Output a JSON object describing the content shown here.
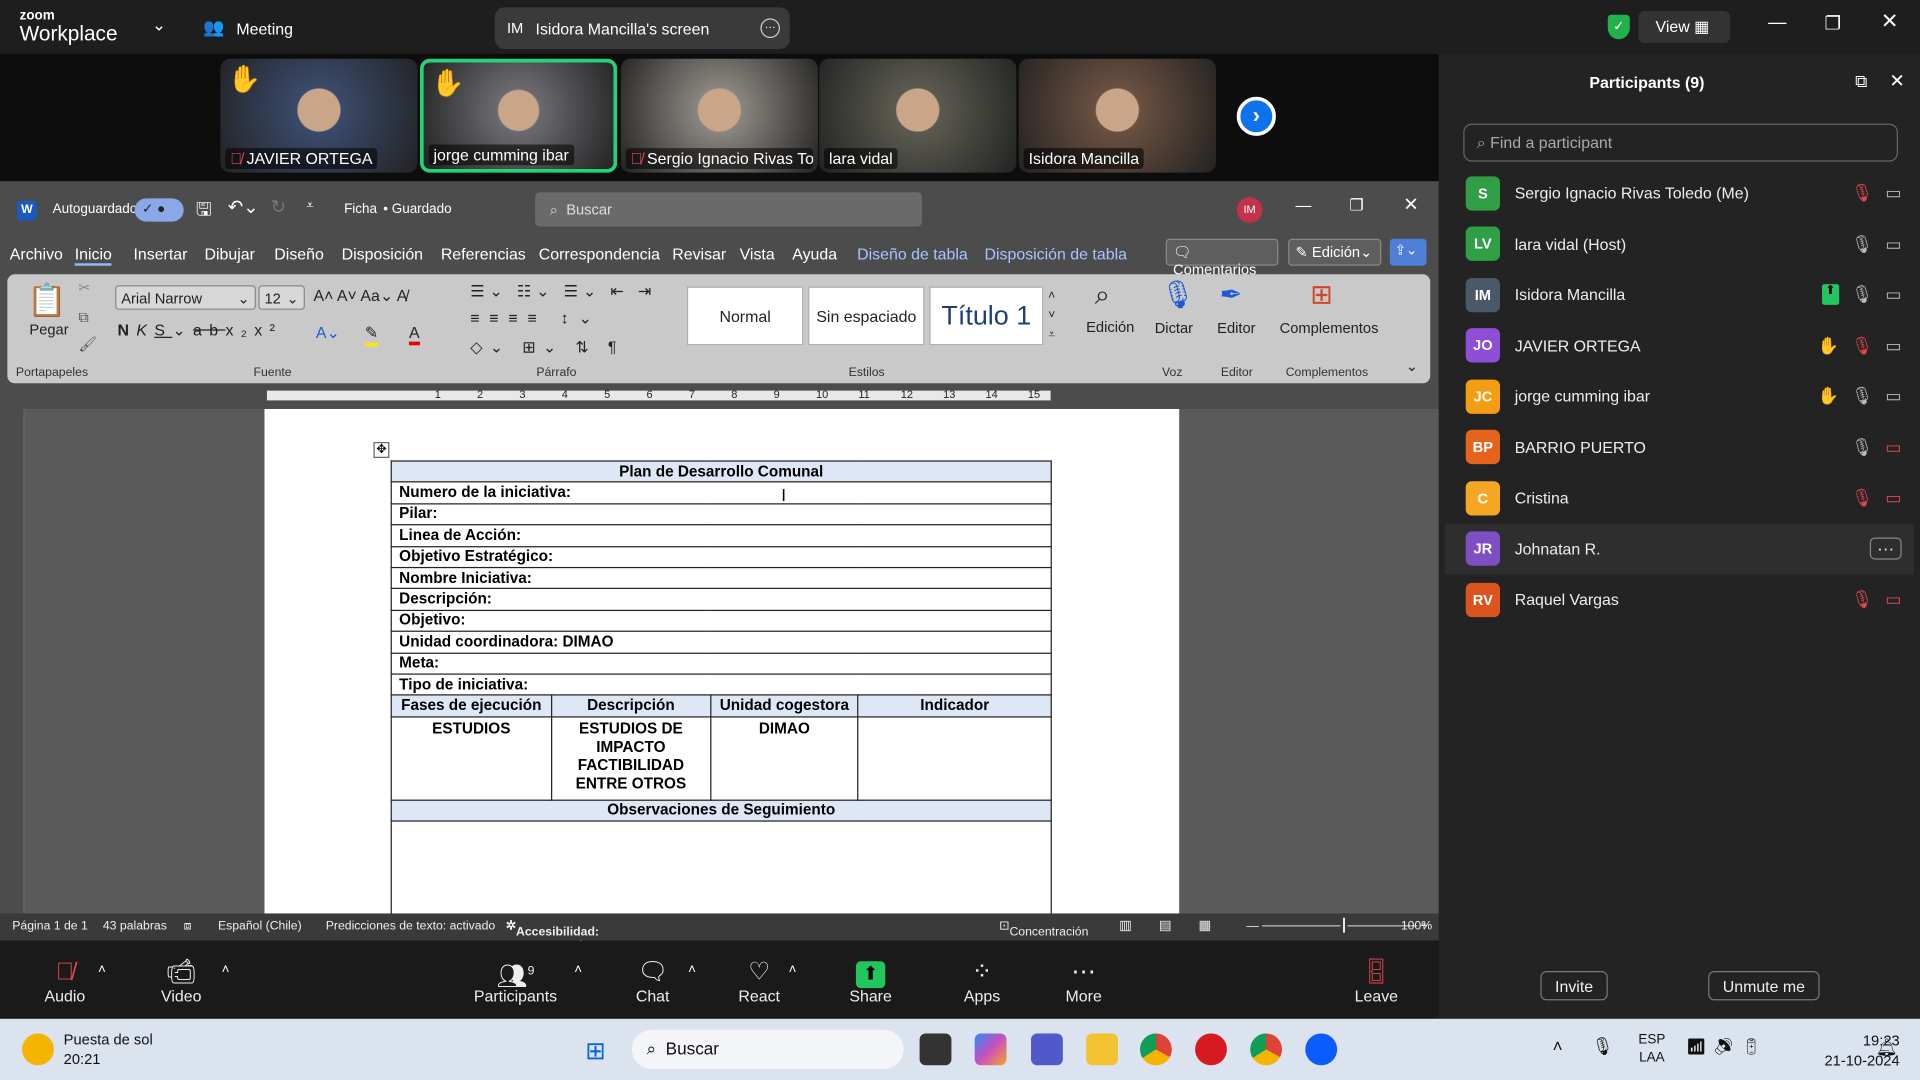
{
  "zoom": {
    "logo_small": "zoom",
    "logo_big": "Workplace",
    "meeting_label": "Meeting",
    "share_pill": "Isidora Mancilla's screen",
    "share_initials": "IM",
    "view_label": "View"
  },
  "videos": [
    {
      "name": "JAVIER ORTEGA",
      "muted": true,
      "hand": true,
      "color": "#3a4a6a"
    },
    {
      "name": "jorge cumming ibar",
      "muted": false,
      "hand": true,
      "active": true,
      "color": "#6a6a70"
    },
    {
      "name": "Sergio Ignacio Rivas To...",
      "muted": true,
      "hand": false,
      "color": "#8a8580"
    },
    {
      "name": "lara vidal",
      "muted": false,
      "hand": false,
      "color": "#5a5a50"
    },
    {
      "name": "Isidora Mancilla",
      "muted": false,
      "hand": false,
      "color": "#6a5040"
    }
  ],
  "word": {
    "autosave": "Autoguardado",
    "doc_name": "Ficha",
    "saved": "• Guardado",
    "search": "Buscar",
    "user_initials": "IM",
    "tabs": [
      "Archivo",
      "Inicio",
      "Insertar",
      "Dibujar",
      "Diseño",
      "Disposición",
      "Referencias",
      "Correspondencia",
      "Revisar",
      "Vista",
      "Ayuda",
      "Diseño de tabla",
      "Disposición de tabla"
    ],
    "comments": "Comentarios",
    "editing": "Edición",
    "ribbon": {
      "paste": "Pegar",
      "font": "Arial Narrow",
      "size": "12",
      "styles": [
        "Normal",
        "Sin espaciado",
        "Título 1"
      ],
      "find": "Edición",
      "dictate": "Dictar",
      "editor": "Editor",
      "addins": "Complementos",
      "groups": [
        "Portapapeles",
        "Fuente",
        "Párrafo",
        "Estilos",
        "Voz",
        "Editor",
        "Complementos"
      ]
    },
    "ruler_numbers": [
      "1",
      "2",
      "3",
      "4",
      "5",
      "6",
      "7",
      "8",
      "9",
      "10",
      "11",
      "12",
      "13",
      "14",
      "15"
    ],
    "document": {
      "title": "Plan de Desarrollo Comunal",
      "fields": [
        "Numero de la iniciativa:",
        "Pilar:",
        "Linea de Acción:",
        "Objetivo Estratégico:",
        "Nombre Iniciativa:",
        "Descripción:",
        "Objetivo:",
        "Unidad coordinadora: DIMAO",
        "Meta:",
        "Tipo de iniciativa:"
      ],
      "headers": [
        "Fases de ejecución",
        "Descripción",
        "Unidad cogestora",
        "Indicador"
      ],
      "row": [
        "ESTUDIOS",
        "ESTUDIOS DE IMPACTO FACTIBILIDAD ENTRE OTROS",
        "DIMAO",
        ""
      ],
      "footer": "Observaciones de Seguimiento"
    },
    "status": {
      "page": "Página 1 de 1",
      "words": "43 palabras",
      "lang": "Español (Chile)",
      "predict": "Predicciones de texto: activado",
      "access": "Accesibilidad: es necesario investigar",
      "focus": "Concentración",
      "zoom": "100%"
    }
  },
  "toolbar": {
    "audio": "Audio",
    "video": "Video",
    "participants": "Participants",
    "participants_count": "9",
    "chat": "Chat",
    "react": "React",
    "share": "Share",
    "apps": "Apps",
    "more": "More",
    "leave": "Leave"
  },
  "panel": {
    "title": "Participants (9)",
    "search_placeholder": "Find a participant",
    "invite": "Invite",
    "unmute": "Unmute me",
    "participants": [
      {
        "initials": "S",
        "name": "Sergio Ignacio Rivas Toledo (Me)",
        "color": "#2f9e44",
        "mic": "muted",
        "video": "on"
      },
      {
        "initials": "LV",
        "name": "lara vidal (Host)",
        "color": "#2f9e44",
        "mic": "on",
        "video": "on"
      },
      {
        "initials": "IM",
        "name": "Isidora Mancilla",
        "color": "#4b5868",
        "mic": "on",
        "video": "on",
        "sharing": true
      },
      {
        "initials": "JO",
        "name": "JAVIER ORTEGA",
        "color": "#8e4fd6",
        "mic": "muted",
        "video": "on",
        "hand": true
      },
      {
        "initials": "JC",
        "name": "jorge cumming ibar",
        "color": "#f29d12",
        "mic": "on",
        "video": "on",
        "hand": true
      },
      {
        "initials": "BP",
        "name": "BARRIO PUERTO",
        "color": "#e3641a",
        "mic": "on",
        "video": "off"
      },
      {
        "initials": "C",
        "name": "Cristina",
        "color": "#f5a623",
        "mic": "muted",
        "video": "off"
      },
      {
        "initials": "JR",
        "name": "Johnatan R.",
        "color": "#7e4fc2",
        "mic": "",
        "video": ""
      },
      {
        "initials": "RV",
        "name": "Raquel Vargas",
        "color": "#d9541e",
        "mic": "muted",
        "video": "off"
      }
    ]
  },
  "taskbar": {
    "weather_title": "Puesta de sol",
    "weather_time": "20:21",
    "search": "Buscar",
    "lang1": "ESP",
    "lang2": "LAA",
    "time": "19:23",
    "date": "21-10-2024"
  }
}
